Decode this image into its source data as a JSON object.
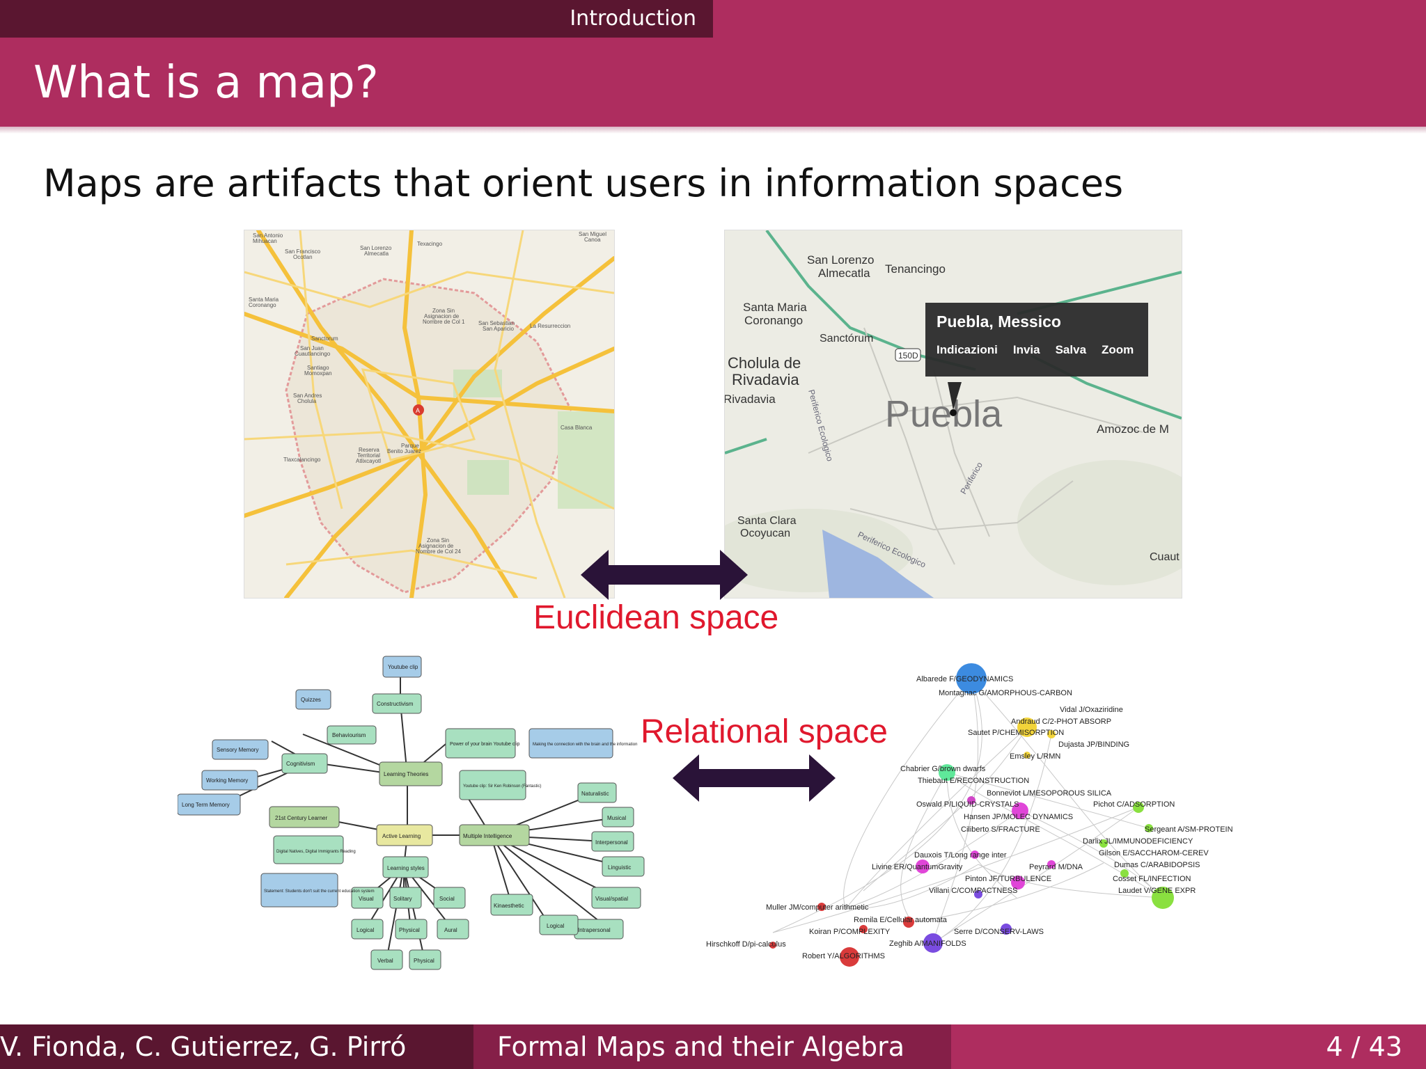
{
  "header": {
    "section": "Introduction",
    "title": "What is a map?"
  },
  "body": {
    "statement": "Maps are artifacts that orient users in information spaces",
    "euclidean_label": "Euclidean space",
    "relational_label": "Relational space"
  },
  "left_map": {
    "places": [
      "San Antonio Mihuacan",
      "San Francisco Ocotlan",
      "San Lorenzo Almecatla",
      "Texacingo",
      "San Miguel Canoa",
      "Santa Maria Coronango",
      "Zona Sin Asignacion de Nombre de Col 1",
      "San Sebastian San Aparicio",
      "La Resurreccion",
      "San Juan Cuautlancingo",
      "Sanctorum",
      "Santiago Momoxpan",
      "San Andres Cholula",
      "Reserva Territorial Atlixcayotl",
      "Parque Benito Juarez",
      "Tlaxcalancingo",
      "Zona Sin Asignacion de Nombre de Col 24",
      "Casa Blanca"
    ],
    "marker": "A"
  },
  "right_map": {
    "places": [
      "San Lorenzo Almecatla",
      "Tenancingo",
      "Santa Maria Coronango",
      "Sanctorum",
      "Cholula de Rivadavia",
      "Puebla",
      "Amozoc de M",
      "Santa Clara Ocoyucan",
      "Cuaut"
    ],
    "roads": [
      "Periferico Ecologico",
      "Periferico Ecologico",
      "Periferico"
    ],
    "shield": "150D",
    "popup": {
      "title": "Puebla, Messico",
      "actions": [
        "Indicazioni",
        "Invia",
        "Salva",
        "Zoom"
      ]
    }
  },
  "concept_map": {
    "nodes": [
      "Youtube clip",
      "Quizzes",
      "Constructivism",
      "Behaviourism",
      "Sensory Memory",
      "Cognitivism",
      "Working Memory",
      "Long Term Memory",
      "Learning Theories",
      "Power of your brain Youtube clip",
      "Making the connection with the brain and the information",
      "Youtube clip: Sir Ken Robinson (Fantastic)",
      "21st Century Learner",
      "Digital Natives, Digital Immigrants Reading",
      "Statement: Students don't suit the current education system",
      "Active Learning",
      "Multiple Intelligence",
      "Naturalistic",
      "Musical",
      "Interpersonal",
      "Linguistic",
      "Visual/spatial",
      "Intrapersonal",
      "Kinaesthetic",
      "Logical",
      "Learning styles",
      "Visual",
      "Solitary",
      "Social",
      "Logical",
      "Physical",
      "Aural",
      "Verbal",
      "Physical"
    ]
  },
  "network": {
    "labels": [
      "Albarede F/GEODYNAMICS",
      "Montagnac G/AMORPHOUS-CARBON",
      "Vidal J/Oxaziridine",
      "Andraud C/2-PHOT ABSORP",
      "Sautet P/CHEMISORPTION",
      "Dujasta JP/BINDING",
      "Emsley L/RMN",
      "Chabrier G/brown dwarfs",
      "Thiebaut E/RECONSTRUCTION",
      "Bonneviot L/MESOPOROUS SILICA",
      "Oswald P/LIQUID-CRYSTALS",
      "Pichot C/ADSORPTION",
      "Hansen JP/MOLEC DYNAMICS",
      "Ciliberto S/FRACTURE",
      "Sergeant A/SM-PROTEIN",
      "Darlix JL/IMMUNODEFICIENCY",
      "Gilson E/SACCHAROM-CEREV",
      "Dauxois T/Long range inter",
      "Dumas C/ARABIDOPSIS",
      "Livine ER/QuantumGravity",
      "Peyrard M/DNA",
      "Pinton JF/TURBULENCE",
      "Cosset FL/INFECTION",
      "Villani C/COMPACTNESS",
      "Laudet V/GENE EXPR",
      "Muller JM/computer arithmetic",
      "Remila E/Cellular automata",
      "Koiran P/COMPLEXITY",
      "Serre D/CONSERV-LAWS",
      "Hirschkoff D/pi-calculus",
      "Zeghib A/MANIFOLDS",
      "Robert Y/ALGORITHMS"
    ]
  },
  "footer": {
    "authors": "V. Fionda, C. Gutierrez, G. Pirró",
    "talk_title": "Formal Maps and their Algebra",
    "page": "4 / 43"
  },
  "colors": {
    "bar_dark": "#5a1630",
    "bar_mid": "#851f48",
    "bar_light": "#ae2d5f",
    "label_red": "#e0182d",
    "arrow": "#2a1338"
  }
}
